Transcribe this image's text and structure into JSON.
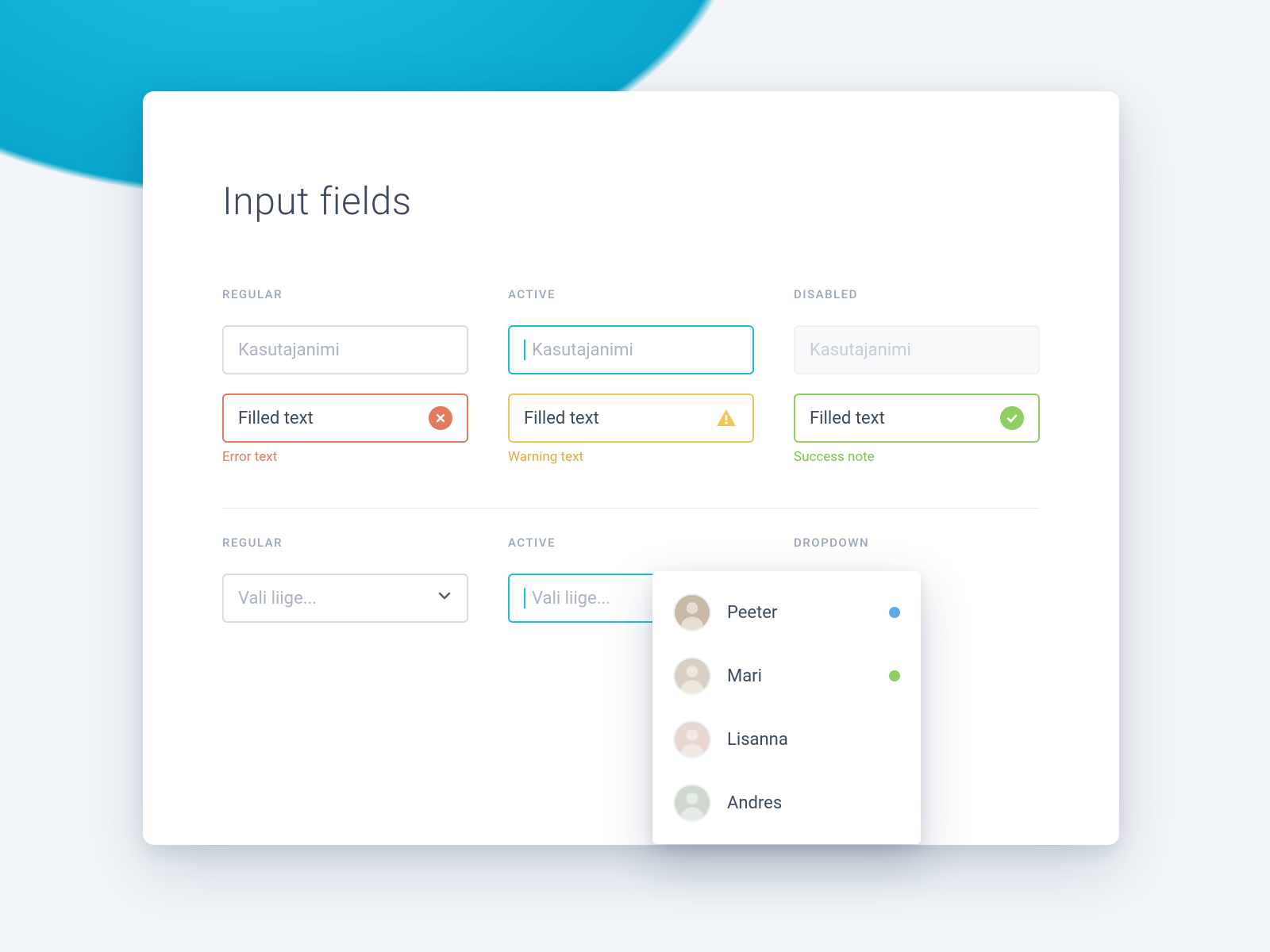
{
  "title": "Input fields",
  "row1": {
    "regular": {
      "label": "REGULAR",
      "placeholder": "Kasutajanimi"
    },
    "active": {
      "label": "ACTIVE",
      "placeholder": "Kasutajanimi"
    },
    "disabled": {
      "label": "DISABLED",
      "placeholder": "Kasutajanimi"
    }
  },
  "row2": {
    "error": {
      "value": "Filled text",
      "helper": "Error text"
    },
    "warning": {
      "value": "Filled text",
      "helper": "Warning text"
    },
    "success": {
      "value": "Filled text",
      "helper": "Success note"
    }
  },
  "selects": {
    "regular": {
      "label": "REGULAR",
      "placeholder": "Vali liige..."
    },
    "active": {
      "label": "ACTIVE",
      "placeholder": "Vali liige..."
    },
    "dropdown": {
      "label": "DROPDOWN"
    }
  },
  "dropdown_items": [
    {
      "name": "Peeter",
      "status": "blue",
      "avatar_bg": "#c7b8a8"
    },
    {
      "name": "Mari",
      "status": "green",
      "avatar_bg": "#d9cfc4"
    },
    {
      "name": "Lisanna",
      "status": "",
      "avatar_bg": "#e6d7d0"
    },
    {
      "name": "Andres",
      "status": "",
      "avatar_bg": "#cfd9d0"
    }
  ]
}
